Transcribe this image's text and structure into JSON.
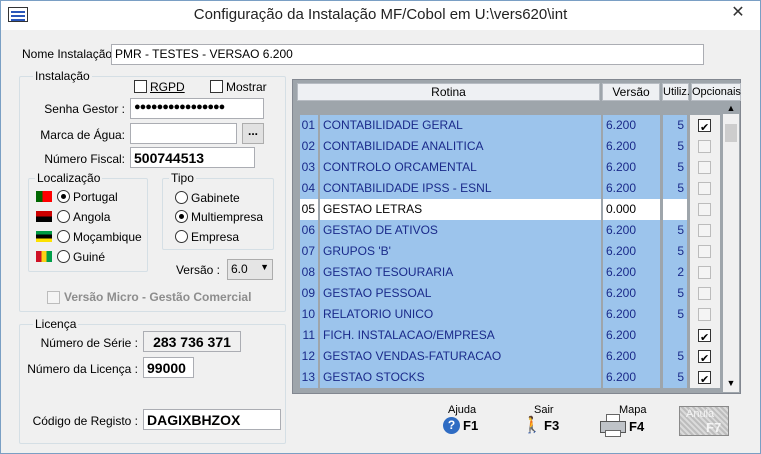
{
  "window": {
    "title": "Configuração da Instalação MF/Cobol em U:\\vers620\\int",
    "close": "✕"
  },
  "nome": {
    "label": "Nome Instalação :",
    "value": "PMR - TESTES - VERSAO 6.200"
  },
  "instalacao": {
    "group": "Instalação",
    "rgpd": "RGPD",
    "mostrar": "Mostrar",
    "senha_label": "Senha Gestor :",
    "senha_value": "●●●●●●●●●●●●●●●●",
    "marca_label": "Marca de Água:",
    "marca_value": "",
    "browse": "...",
    "fiscal_label": "Número Fiscal:",
    "fiscal_value": "500744513",
    "loc_group": "Localização",
    "locs": [
      "Portugal",
      "Angola",
      "Moçambique",
      "Guiné"
    ],
    "tipo_group": "Tipo",
    "tipos": [
      "Gabinete",
      "Multiempresa",
      "Empresa"
    ],
    "versao_label": "Versão :",
    "versao_value": "6.0",
    "micro": "Versão Micro - Gestão Comercial"
  },
  "licenca": {
    "group": "Licença",
    "serie_label": "Número de Série :",
    "serie_value": "283 736 371",
    "lic_label": "Número da Licença :",
    "lic_value": "99000",
    "reg_label": "Código de Registo :",
    "reg_value": "DAGIXBHZOX"
  },
  "grid": {
    "headers": [
      "Rotina",
      "Versão",
      "Utiliz.",
      "Opcionais"
    ],
    "rows": [
      {
        "n": "01",
        "name": "CONTABILIDADE GERAL",
        "ver": "6.200",
        "util": "5",
        "opt": "checked"
      },
      {
        "n": "02",
        "name": "CONTABILIDADE ANALITICA",
        "ver": "6.200",
        "util": "5",
        "opt": "disabled"
      },
      {
        "n": "03",
        "name": "CONTROLO ORCAMENTAL",
        "ver": "6.200",
        "util": "5",
        "opt": "disabled"
      },
      {
        "n": "04",
        "name": "CONTABILIDADE IPSS - ESNL",
        "ver": "6.200",
        "util": "5",
        "opt": "disabled"
      },
      {
        "n": "05",
        "name": "GESTAO LETRAS",
        "ver": "0.000",
        "util": "",
        "opt": "disabled"
      },
      {
        "n": "06",
        "name": "GESTAO DE ATIVOS",
        "ver": "6.200",
        "util": "5",
        "opt": "disabled"
      },
      {
        "n": "07",
        "name": "GRUPOS 'B'",
        "ver": "6.200",
        "util": "5",
        "opt": "disabled"
      },
      {
        "n": "08",
        "name": "GESTAO TESOURARIA",
        "ver": "6.200",
        "util": "2",
        "opt": "disabled"
      },
      {
        "n": "09",
        "name": "GESTAO PESSOAL",
        "ver": "6.200",
        "util": "5",
        "opt": "disabled"
      },
      {
        "n": "10",
        "name": "RELATORIO UNICO",
        "ver": "6.200",
        "util": "5",
        "opt": "disabled"
      },
      {
        "n": "11",
        "name": "FICH. INSTALACAO/EMPRESA",
        "ver": "6.200",
        "util": "",
        "opt": "checked"
      },
      {
        "n": "12",
        "name": "GESTAO VENDAS-FATURACAO",
        "ver": "6.200",
        "util": "5",
        "opt": "checked"
      },
      {
        "n": "13",
        "name": "GESTAO STOCKS",
        "ver": "6.200",
        "util": "5",
        "opt": "checked"
      }
    ]
  },
  "buttons": {
    "ajuda": "Ajuda",
    "ajuda_key": "F1",
    "sair": "Sair",
    "sair_key": "F3",
    "mapa": "Mapa",
    "mapa_key": "F4",
    "anula": "Anula",
    "anula_key": "F7"
  },
  "icons": [
    "app-icon",
    "close-icon",
    "flag-portugal-icon",
    "flag-angola-icon",
    "flag-mocambique-icon",
    "flag-guine-icon",
    "help-icon",
    "exit-icon",
    "printer-icon"
  ]
}
